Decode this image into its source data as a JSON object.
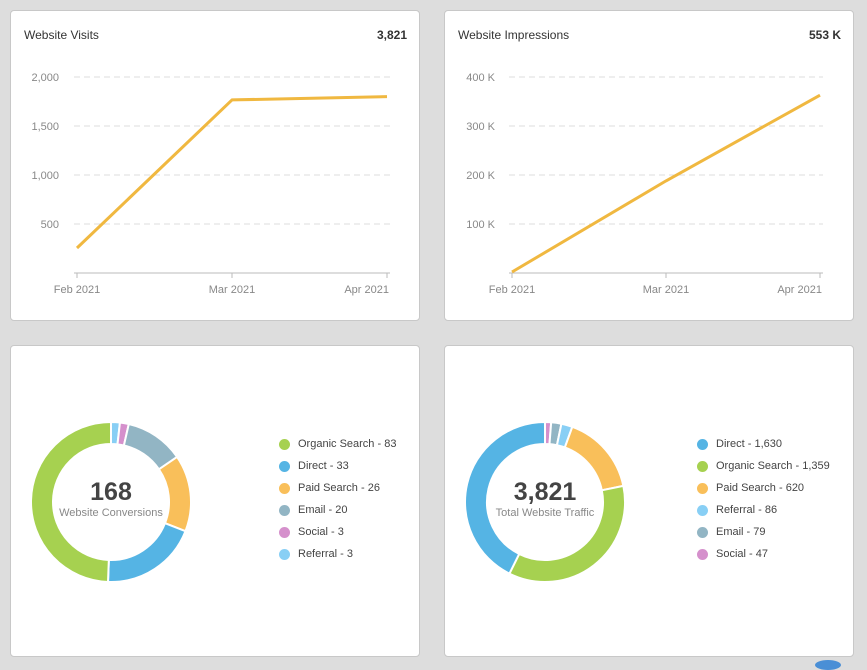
{
  "cards": {
    "visits": {
      "title": "Website Visits",
      "value": "3,821"
    },
    "impressions": {
      "title": "Website Impressions",
      "value": "553 K"
    },
    "conversions": {
      "big": "168",
      "sub": "Website Conversions"
    },
    "traffic": {
      "big": "3,821",
      "sub": "Total Website Traffic"
    }
  },
  "colors": {
    "line": "#f0b840",
    "organic": "#a6d150",
    "direct": "#55b4e4",
    "paid": "#f9bf5a",
    "email": "#92b5c4",
    "social": "#d590cc",
    "referral": "#88cff5"
  },
  "chart_data": [
    {
      "type": "line",
      "title": "Website Visits",
      "categories": [
        "Feb 2021",
        "Mar 2021",
        "Apr 2021"
      ],
      "series": [
        {
          "name": "Website Visits",
          "values": [
            255,
            1766,
            1800
          ]
        }
      ],
      "yticks": [
        500,
        1000,
        1500,
        2000
      ],
      "ytick_labels": [
        "500",
        "1,000",
        "1,500",
        "2,000"
      ],
      "ylim": [
        0,
        2000
      ],
      "grid": true
    },
    {
      "type": "line",
      "title": "Website Impressions",
      "categories": [
        "Feb 2021",
        "Mar 2021",
        "Apr 2021"
      ],
      "series": [
        {
          "name": "Website Impressions",
          "values": [
            2000,
            188000,
            363000
          ]
        }
      ],
      "yticks": [
        100000,
        200000,
        300000,
        400000
      ],
      "ytick_labels": [
        "100 K",
        "200 K",
        "300 K",
        "400 K"
      ],
      "ylim": [
        0,
        400000
      ],
      "grid": true
    },
    {
      "type": "pie",
      "title": "Website Conversions",
      "total": 168,
      "slices": [
        {
          "name": "Referral",
          "value": 3,
          "color_key": "referral",
          "label": "Referral - 3"
        },
        {
          "name": "Social",
          "value": 3,
          "color_key": "social",
          "label": "Social - 3"
        },
        {
          "name": "Email",
          "value": 20,
          "color_key": "email",
          "label": "Email - 20"
        },
        {
          "name": "Paid Search",
          "value": 26,
          "color_key": "paid",
          "label": "Paid Search - 26"
        },
        {
          "name": "Direct",
          "value": 33,
          "color_key": "direct",
          "label": "Direct - 33"
        },
        {
          "name": "Organic Search",
          "value": 83,
          "color_key": "organic",
          "label": "Organic Search - 83"
        }
      ],
      "legend": [
        {
          "label": "Organic Search - 83",
          "color_key": "organic"
        },
        {
          "label": "Direct - 33",
          "color_key": "direct"
        },
        {
          "label": "Paid Search - 26",
          "color_key": "paid"
        },
        {
          "label": "Email - 20",
          "color_key": "email"
        },
        {
          "label": "Social - 3",
          "color_key": "social"
        },
        {
          "label": "Referral - 3",
          "color_key": "referral"
        }
      ],
      "legend_position": "right"
    },
    {
      "type": "pie",
      "title": "Total Website Traffic",
      "total": 3821,
      "slices": [
        {
          "name": "Social",
          "value": 47,
          "color_key": "social",
          "label": "Social - 47"
        },
        {
          "name": "Email",
          "value": 79,
          "color_key": "email",
          "label": "Email - 79"
        },
        {
          "name": "Referral",
          "value": 86,
          "color_key": "referral",
          "label": "Referral - 86"
        },
        {
          "name": "Paid Search",
          "value": 620,
          "color_key": "paid",
          "label": "Paid Search - 620"
        },
        {
          "name": "Organic Search",
          "value": 1359,
          "color_key": "organic",
          "label": "Organic Search - 1,359"
        },
        {
          "name": "Direct",
          "value": 1630,
          "color_key": "direct",
          "label": "Direct - 1,630"
        }
      ],
      "legend": [
        {
          "label": "Direct - 1,630",
          "color_key": "direct"
        },
        {
          "label": "Organic Search - 1,359",
          "color_key": "organic"
        },
        {
          "label": "Paid Search - 620",
          "color_key": "paid"
        },
        {
          "label": "Referral - 86",
          "color_key": "referral"
        },
        {
          "label": "Email - 79",
          "color_key": "email"
        },
        {
          "label": "Social - 47",
          "color_key": "social"
        }
      ],
      "legend_position": "right"
    }
  ]
}
